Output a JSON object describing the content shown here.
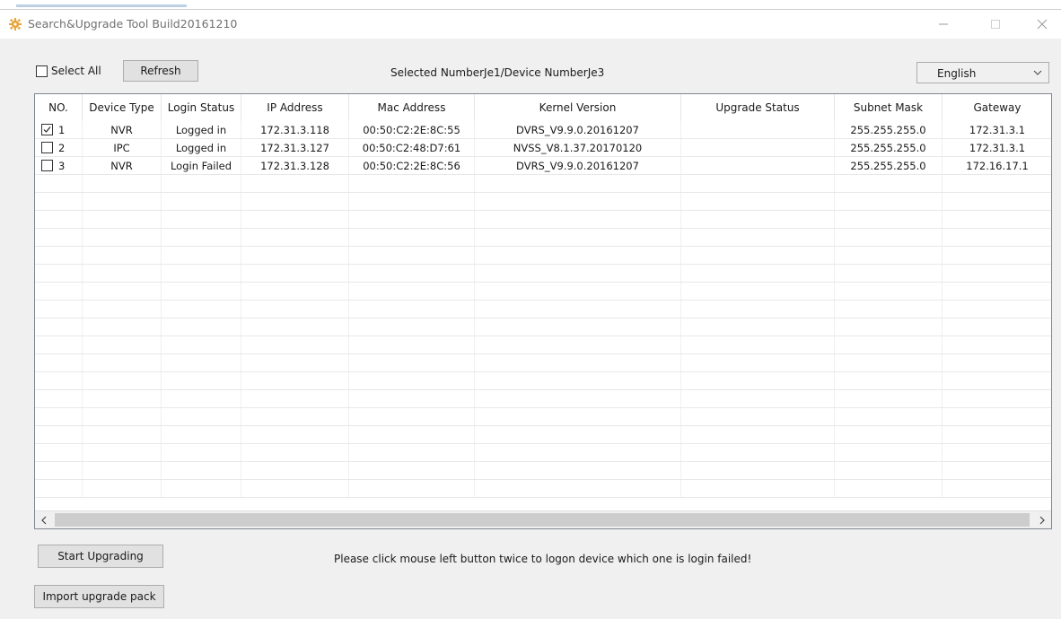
{
  "window": {
    "title": "Search&Upgrade Tool Build20161210"
  },
  "toolbar": {
    "select_all_label": "Select All",
    "refresh_label": "Refresh",
    "selected_info": "Selected NumberJe1/Device NumberJe3",
    "language": "English"
  },
  "table": {
    "columns": [
      "NO.",
      "Device Type",
      "Login Status",
      "IP Address",
      "Mac Address",
      "Kernel Version",
      "Upgrade Status",
      "Subnet Mask",
      "Gateway"
    ],
    "rows": [
      {
        "checked": true,
        "no": "1",
        "device_type": "NVR",
        "login_status": "Logged in",
        "ip": "172.31.3.118",
        "mac": "00:50:C2:2E:8C:55",
        "kernel": "DVRS_V9.9.0.20161207",
        "upgrade_status": "",
        "subnet": "255.255.255.0",
        "gateway": "172.31.3.1"
      },
      {
        "checked": false,
        "no": "2",
        "device_type": "IPC",
        "login_status": "Logged in",
        "ip": "172.31.3.127",
        "mac": "00:50:C2:48:D7:61",
        "kernel": "NVSS_V8.1.37.20170120",
        "upgrade_status": "",
        "subnet": "255.255.255.0",
        "gateway": "172.31.3.1"
      },
      {
        "checked": false,
        "no": "3",
        "device_type": "NVR",
        "login_status": "Login Failed",
        "ip": "172.31.3.128",
        "mac": "00:50:C2:2E:8C:56",
        "kernel": "DVRS_V9.9.0.20161207",
        "upgrade_status": "",
        "subnet": "255.255.255.0",
        "gateway": "172.16.17.1"
      }
    ]
  },
  "actions": {
    "start_label": "Start Upgrading",
    "import_label": "Import upgrade pack"
  },
  "hint": "Please click mouse left button twice to logon device which one is login failed!",
  "icons": {
    "app": "gear-icon",
    "minimize": "minimize-icon",
    "maximize": "maximize-icon",
    "close": "close-icon",
    "dropdown": "chevron-down-icon",
    "scroll_left": "chevron-left-icon",
    "scroll_right": "chevron-right-icon",
    "check": "check-icon"
  },
  "colors": {
    "window_bg": "#f0f0f0",
    "app_icon": "#e8a33a",
    "button_bg": "#e1e1e1",
    "grid_border": "#828790"
  }
}
